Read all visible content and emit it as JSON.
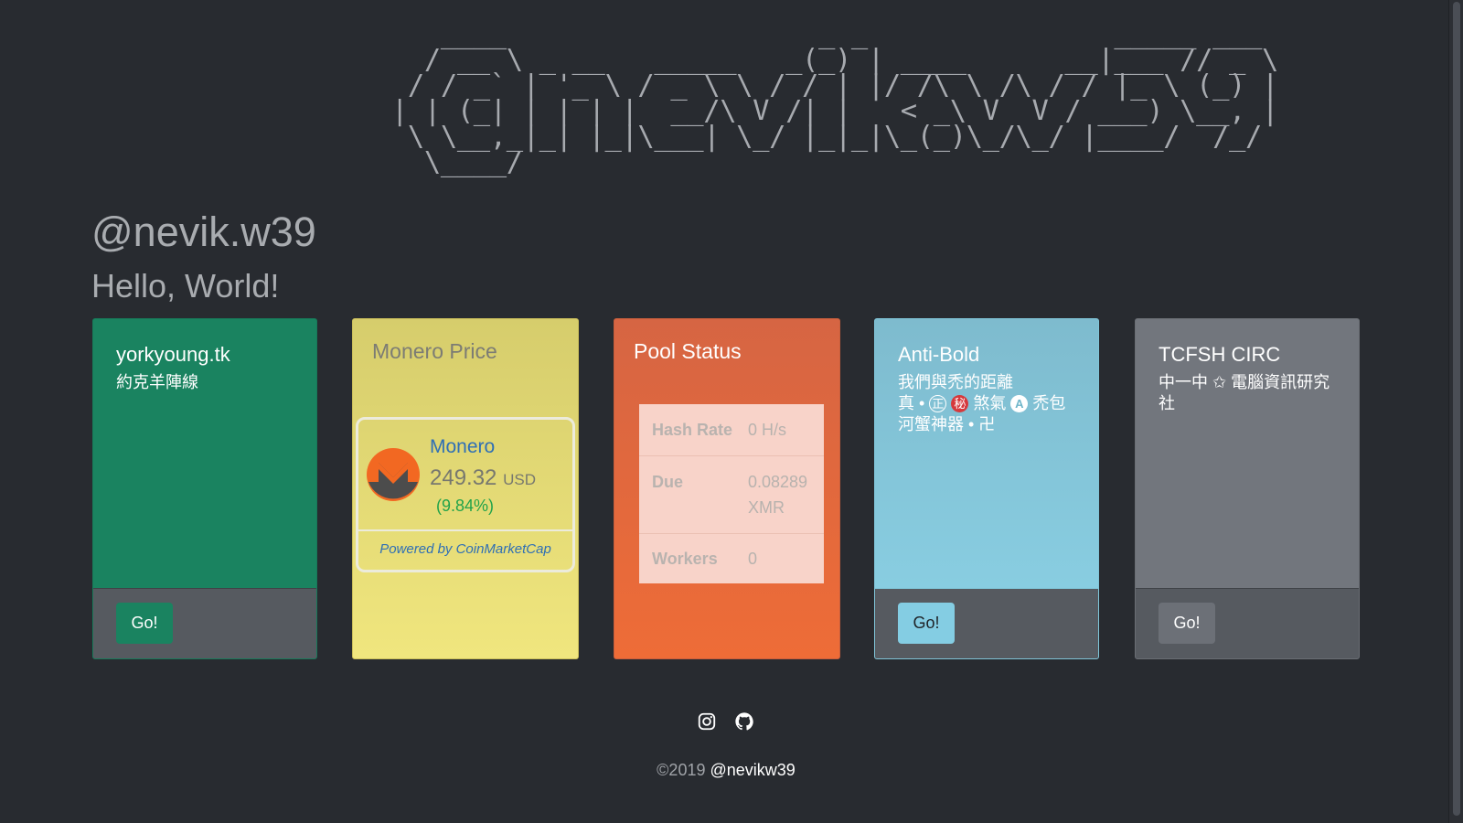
{
  "ascii_art": "    ____                   _ _               _____ ___  \n   / __ \\ _ __   _____   _(_) | ____      __|___ // _ \\ \n  / / _` | '_ \\ / _ \\ \\ / / | |/ /\\ \\ /\\ / / |_ \\ (_) |\n | | (_| | | | |  __/\\ V /| |   < _\\ V  V / ___) \\__, |\n  \\ \\__,_|_| |_|\\___| \\_/ |_|_|\\_(_)\\_/\\_/ |____/  /_/ \n   \\____/                                              ",
  "header": {
    "title": "@nevik.w39",
    "subtitle": "Hello, World!"
  },
  "cards": {
    "york": {
      "title": "yorkyoung.tk",
      "desc": "約克羊陣線",
      "button": "Go!"
    },
    "xmr": {
      "title": "Monero Price",
      "coin_name": "Monero",
      "price": "249.32",
      "currency": "USD",
      "change": "(9.84%)",
      "powered_by": "Powered by CoinMarketCap"
    },
    "pool": {
      "title": "Pool Status",
      "rows": [
        {
          "label": "Hash Rate",
          "value": "0 H/s"
        },
        {
          "label": "Due",
          "value": "0.08289 XMR"
        },
        {
          "label": "Workers",
          "value": "0"
        }
      ]
    },
    "anti": {
      "title": "Anti-Bold",
      "line1": "我們與禿的距離",
      "line2_a": "真 • ",
      "circ_1": "正",
      "circ_2": "秘",
      "line2_b": " 煞氣 ",
      "circ_3": "A",
      "line2_c": " 禿包",
      "line3": "河蟹神器 • 卍",
      "button": "Go!"
    },
    "tcfsh": {
      "title": "TCFSH CIRC",
      "desc": "中一中 ✩ 電腦資訊研究社",
      "button": "Go!"
    }
  },
  "footer": {
    "copyright": "©2019 ",
    "handle": "@nevikw39",
    "icons": [
      "instagram-icon",
      "github-icon"
    ]
  },
  "colors": {
    "background": "#282b30",
    "green_card": "#1a8360",
    "yellow_card": "#e9df77",
    "orange_card": "#e6693c",
    "cyan_card": "#86cbe0",
    "gray_card": "#72767d"
  }
}
